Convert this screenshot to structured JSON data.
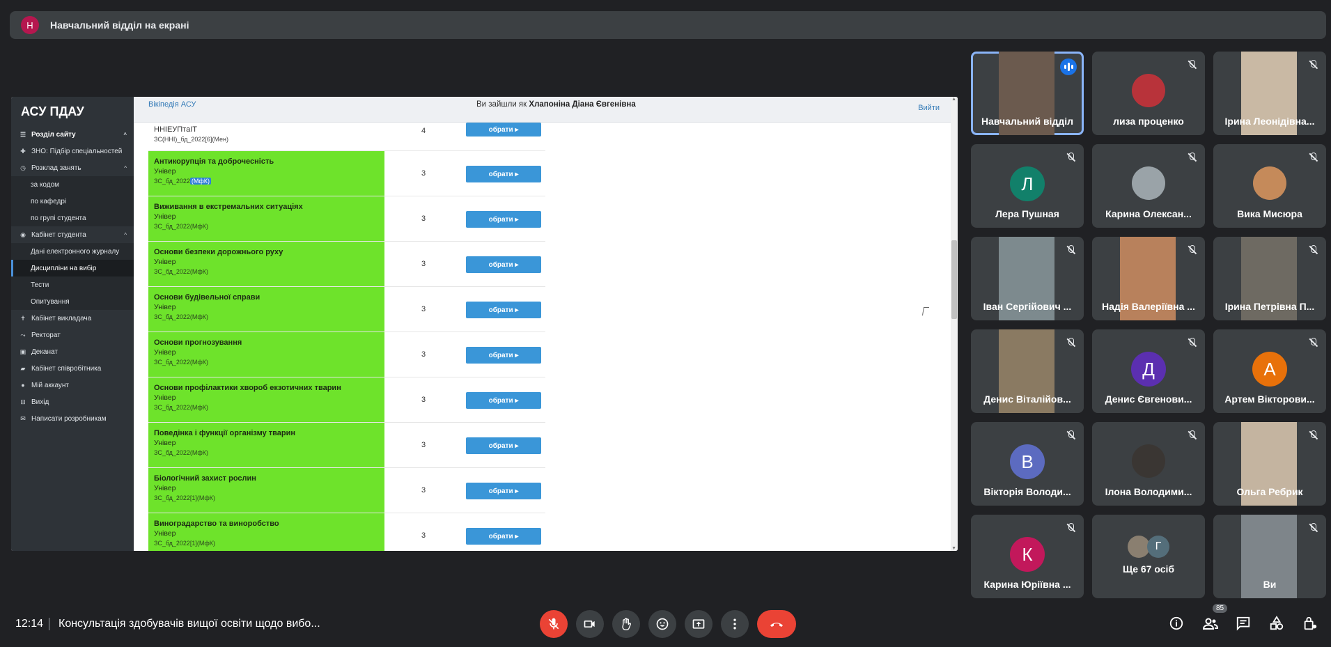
{
  "presenter": {
    "avatar_letter": "Н",
    "title": "Навчальний відділ на екрані"
  },
  "site": {
    "brand": "АСУ ПДАУ",
    "sidebar": [
      {
        "label": "Розділ сайту",
        "icon": "list-icon",
        "type": "section",
        "caret": "^"
      },
      {
        "label": "ЗНО: Підбір спеціальностей",
        "icon": "puzzle-icon",
        "type": "item"
      },
      {
        "label": "Розклад занять",
        "icon": "clock-icon",
        "type": "item",
        "caret": "^"
      },
      {
        "label": "за кодом",
        "type": "sub"
      },
      {
        "label": "по кафедрі",
        "type": "sub"
      },
      {
        "label": "по групі студента",
        "type": "sub"
      },
      {
        "label": "Кабінет студента",
        "icon": "user-circle-icon",
        "type": "item",
        "caret": "^"
      },
      {
        "label": "Дані електронного журналу",
        "type": "sub"
      },
      {
        "label": "Дисципліни на вибір",
        "type": "sub",
        "active": true
      },
      {
        "label": "Тести",
        "type": "sub"
      },
      {
        "label": "Опитування",
        "type": "sub"
      },
      {
        "label": "Кабінет викладача",
        "icon": "teacher-icon",
        "type": "item"
      },
      {
        "label": "Ректорат",
        "icon": "chart-icon",
        "type": "item"
      },
      {
        "label": "Деканат",
        "icon": "building-icon",
        "type": "item"
      },
      {
        "label": "Кабінет співробітника",
        "icon": "briefcase-icon",
        "type": "item"
      },
      {
        "label": "Мій аккаунт",
        "icon": "account-icon",
        "type": "item"
      },
      {
        "label": "Вихід",
        "icon": "exit-icon",
        "type": "item"
      },
      {
        "label": "Написати розробникам",
        "icon": "mail-icon",
        "type": "item"
      }
    ],
    "topbar": {
      "wiki_link": "Вікіпедія АСУ",
      "logged_in_prefix": "Ви зайшли як",
      "user_name": "Хлапоніна Діана Євгенівна",
      "logout": "Вийти"
    },
    "choose_label": "обрати ▸",
    "disciplines": [
      {
        "title": "ННІЕУПтаІТ",
        "faculty": "",
        "code": "ЗС(ННІ)_бд_2022[6](Мен)",
        "credits": "4",
        "first": true
      },
      {
        "title": "Антикорупція та доброчесність",
        "faculty": "Універ",
        "code": "ЗС_бд_2022",
        "code_highlight": "(МфК)",
        "credits": "3"
      },
      {
        "title": "Виживання в екстремальних ситуаціях",
        "faculty": "Універ",
        "code": "ЗС_бд_2022(МфК)",
        "credits": "3"
      },
      {
        "title": "Основи безпеки дорожнього руху",
        "faculty": "Універ",
        "code": "ЗС_бд_2022(МфК)",
        "credits": "3"
      },
      {
        "title": "Основи будівельної справи",
        "faculty": "Універ",
        "code": "ЗС_бд_2022(МфК)",
        "credits": "3"
      },
      {
        "title": "Основи прогнозування",
        "faculty": "Універ",
        "code": "ЗС_бд_2022(МфК)",
        "credits": "3"
      },
      {
        "title": "Основи профілактики хвороб екзотичних тварин",
        "faculty": "Універ",
        "code": "ЗС_бд_2022(МфК)",
        "credits": "3"
      },
      {
        "title": "Поведінка і функції організму тварин",
        "faculty": "Універ",
        "code": "ЗС_бд_2022(МфК)",
        "credits": "3"
      },
      {
        "title": "Біологічний захист рослин",
        "faculty": "Універ",
        "code": "ЗС_бд_2022[1](МфК)",
        "credits": "3"
      },
      {
        "title": "Виноградарство та виноробство",
        "faculty": "Універ",
        "code": "ЗС_бд_2022[1](МфК)",
        "credits": "3"
      }
    ]
  },
  "participants": [
    {
      "name": "Навчальний відділ",
      "kind": "photo",
      "photo": "#6b5a4e",
      "speaking": true
    },
    {
      "name": "лиза проценко",
      "kind": "small-photo",
      "photo": "#b8333a"
    },
    {
      "name": "Ірина Леонідівна...",
      "kind": "photo",
      "photo": "#c9b9a4"
    },
    {
      "name": "Лера Пушная",
      "kind": "letter",
      "letter": "Л",
      "color": "#12806a"
    },
    {
      "name": "Карина Олексан...",
      "kind": "small-photo",
      "photo": "#9aa3a8"
    },
    {
      "name": "Вика Мисюра",
      "kind": "small-photo",
      "photo": "#c58a5a"
    },
    {
      "name": "Іван Сергійович ...",
      "kind": "photo",
      "photo": "#7d8a8e"
    },
    {
      "name": "Надія Валеріївна ...",
      "kind": "photo",
      "photo": "#b8815c"
    },
    {
      "name": "Ірина Петрівна П...",
      "kind": "photo",
      "photo": "#6e6a62"
    },
    {
      "name": "Денис Віталійов...",
      "kind": "photo",
      "photo": "#8a7a62"
    },
    {
      "name": "Денис Євгенови...",
      "kind": "letter",
      "letter": "Д",
      "color": "#5b2fb0"
    },
    {
      "name": "Артем Вікторови...",
      "kind": "letter",
      "letter": "А",
      "color": "#e8710a"
    },
    {
      "name": "Вікторія Володи...",
      "kind": "letter",
      "letter": "В",
      "color": "#5c6bc0"
    },
    {
      "name": "Ілона Володими...",
      "kind": "small-photo",
      "photo": "#3a3633"
    },
    {
      "name": "Ольга Ребрик",
      "kind": "photo",
      "photo": "#c4b4a0"
    },
    {
      "name": "Карина Юріївна ...",
      "kind": "letter",
      "letter": "К",
      "color": "#c2185b"
    },
    {
      "name": "Ще 67 осіб",
      "kind": "more",
      "letters": [
        "",
        "Г"
      ]
    },
    {
      "name": "Ви",
      "kind": "photo",
      "photo": "#7e858a"
    }
  ],
  "bottom": {
    "time": "12:14",
    "meeting_title": "Консультація здобувачів вищої освіти щодо вибо...",
    "people_count": "85"
  }
}
